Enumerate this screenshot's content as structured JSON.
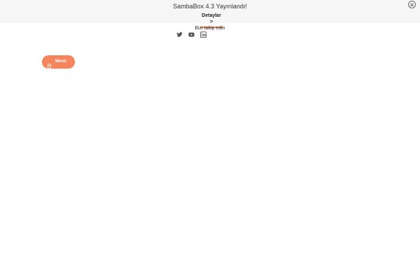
{
  "announcement": {
    "title": "SambaBox 4.3 Yayınlandı!",
    "link_label": "Detaylar >",
    "close_icon": "close-circle-icon"
  },
  "social": {
    "label": "Bizi takip edin",
    "icons": [
      "twitter-icon",
      "youtube-icon",
      "linkedin-icon"
    ]
  },
  "menu_button": {
    "label": "Menü",
    "icon": "menu-icon",
    "color": "#f5855c"
  },
  "colors": {
    "accent": "#f07b4f",
    "announcement_bg": "#f6f6f6",
    "icon": "#555555"
  }
}
